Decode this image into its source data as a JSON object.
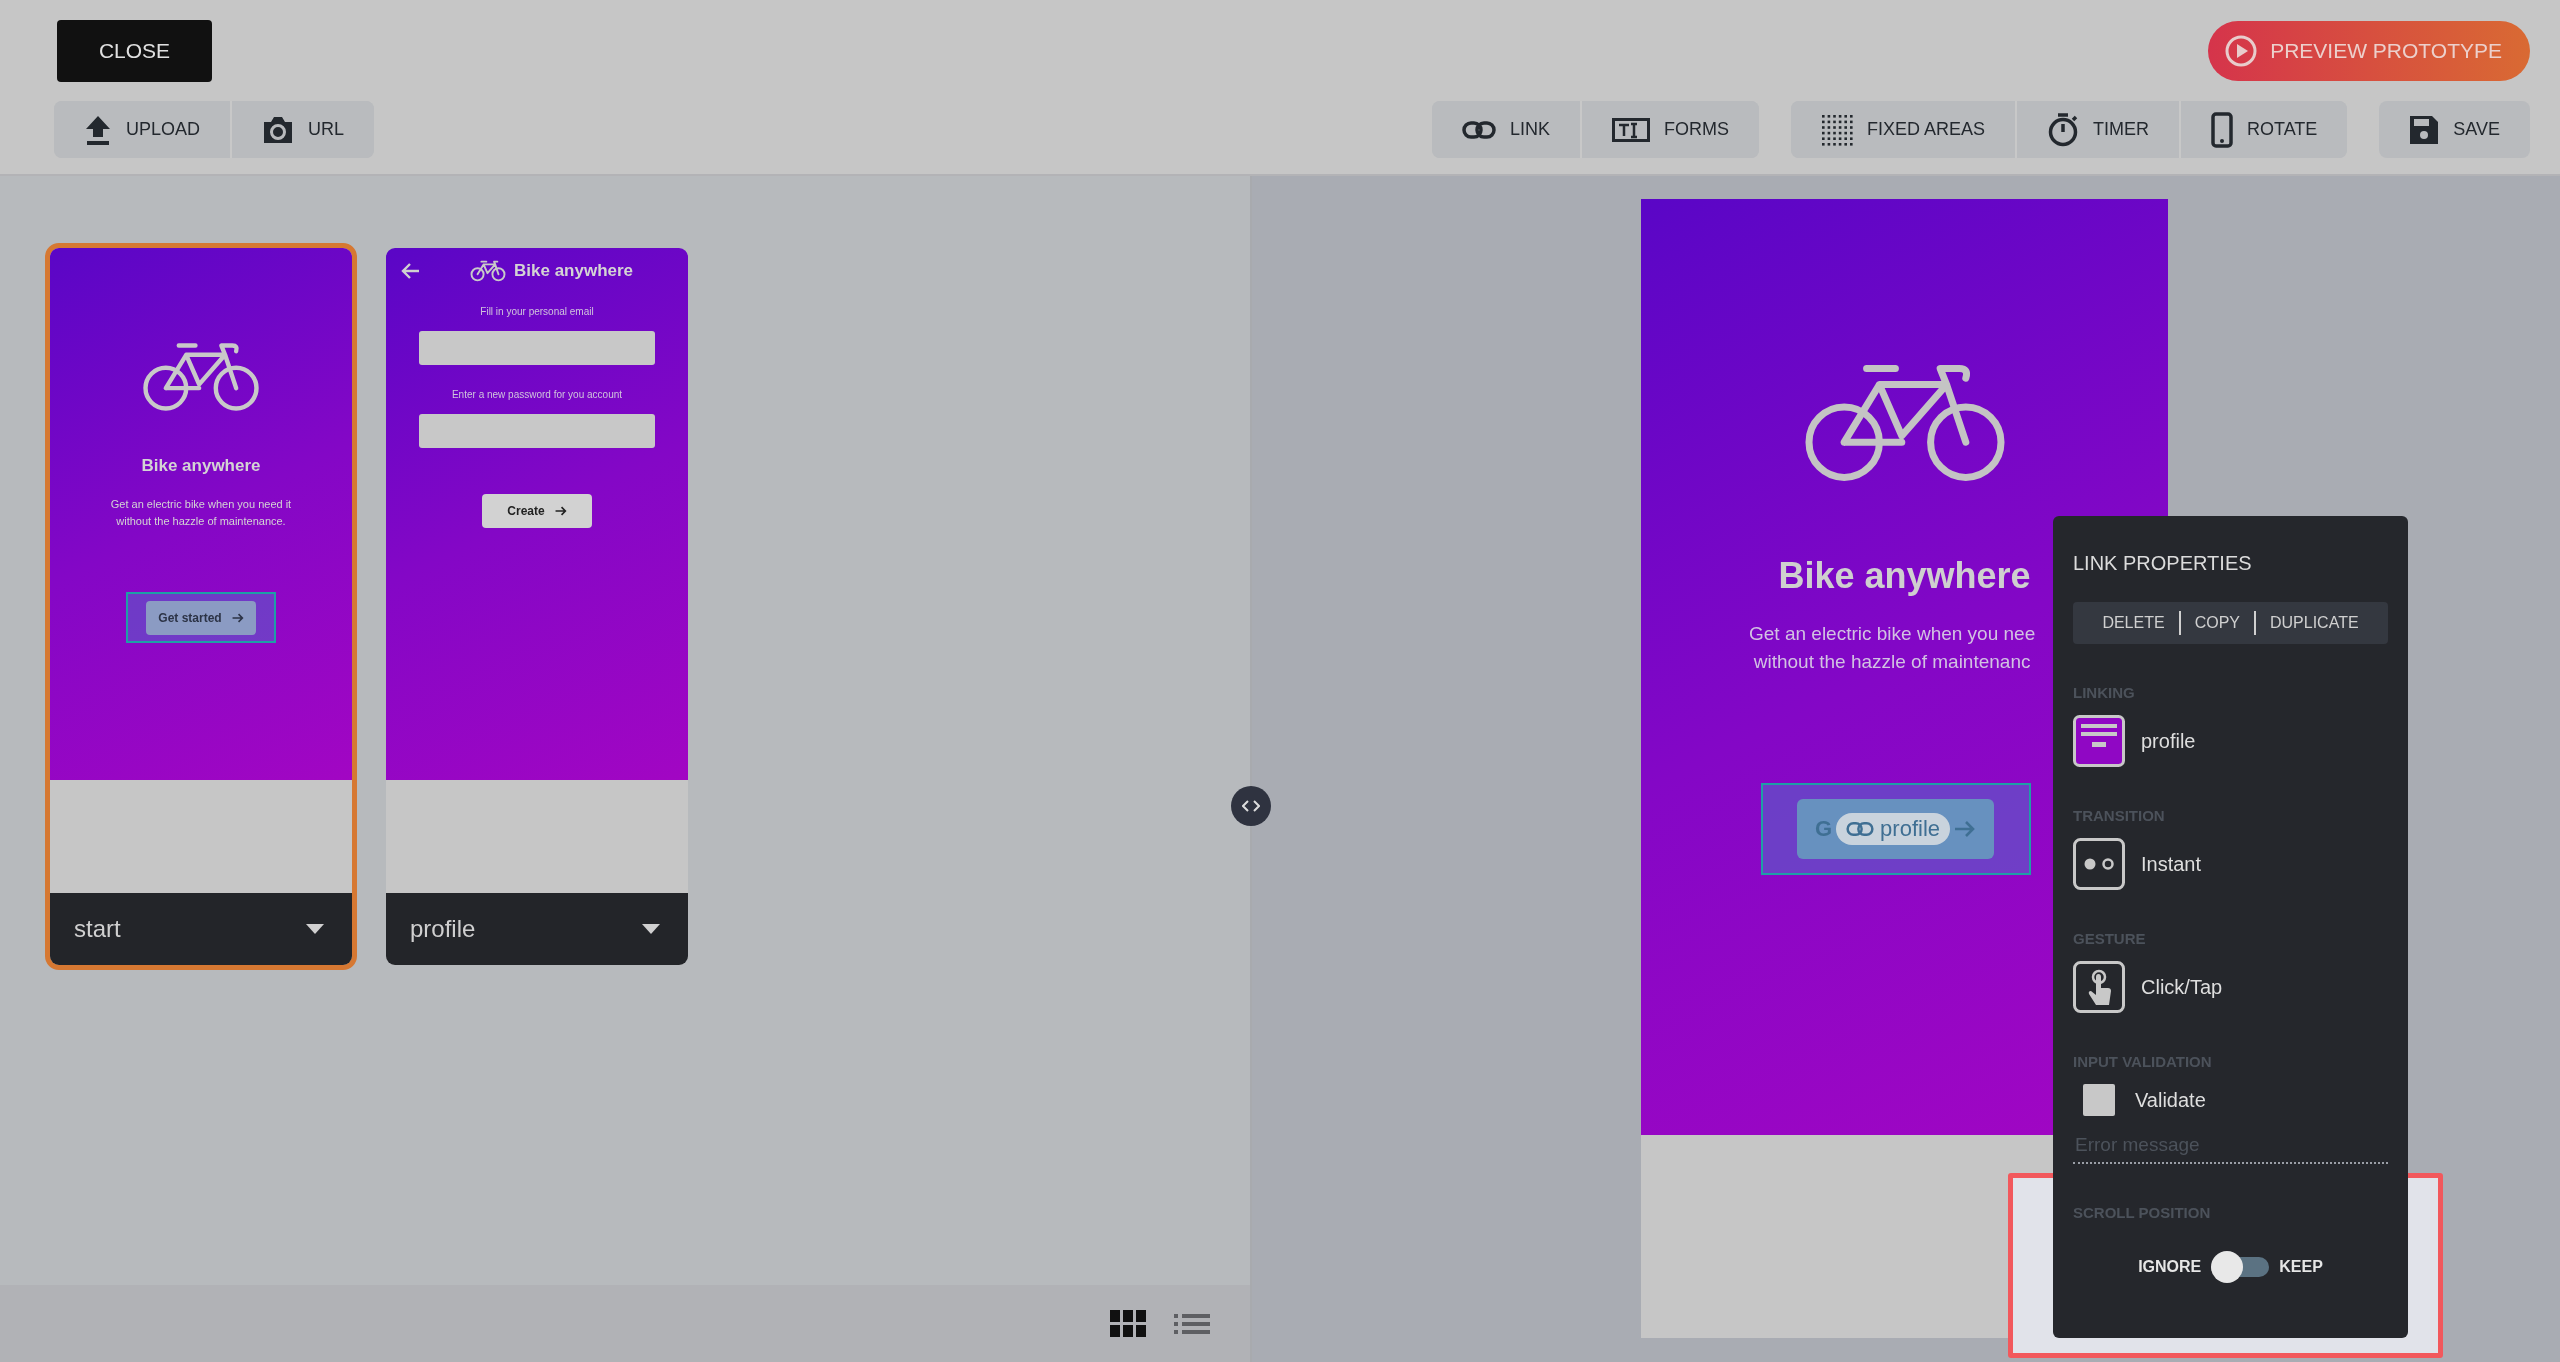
{
  "toolbar": {
    "close": "CLOSE",
    "preview": "PREVIEW PROTOTYPE",
    "upload": "UPLOAD",
    "url": "URL",
    "link": "LINK",
    "forms": "FORMS",
    "fixed_areas": "FIXED AREAS",
    "timer": "TIMER",
    "rotate": "ROTATE",
    "save": "SAVE"
  },
  "screens": [
    {
      "kind": "intro",
      "name": "start",
      "selected": true,
      "title": "Bike anywhere",
      "description": "Get an electric bike when you need it without the hazzle of maintenance.",
      "button": "Get started"
    },
    {
      "kind": "form",
      "name": "profile",
      "selected": false,
      "title": "Bike anywhere",
      "fields": [
        {
          "label": "Fill in your personal email"
        },
        {
          "label": "Enter a new password for you account"
        }
      ],
      "button": "Create"
    }
  ],
  "view_modes": [
    {
      "selected": true
    },
    {
      "selected": false
    }
  ],
  "preview": {
    "title": "Bike anywhere",
    "description_lines": [
      "Get an electric bike when you nee",
      "without the hazzle of maintenanc"
    ],
    "button_visible_text": "G",
    "link_chip": "profile"
  },
  "panel": {
    "title": "LINK PROPERTIES",
    "actions": [
      "DELETE",
      "COPY",
      "DUPLICATE"
    ],
    "linking": {
      "label": "LINKING",
      "value": "profile"
    },
    "transition": {
      "label": "TRANSITION",
      "value": "Instant"
    },
    "gesture": {
      "label": "GESTURE",
      "value": "Click/Tap"
    },
    "validation": {
      "label": "INPUT VALIDATION",
      "checkbox_label": "Validate",
      "checked": false,
      "placeholder": "Error message"
    },
    "scroll": {
      "label": "SCROLL POSITION",
      "left": "IGNORE",
      "right": "KEEP",
      "on": false
    }
  }
}
